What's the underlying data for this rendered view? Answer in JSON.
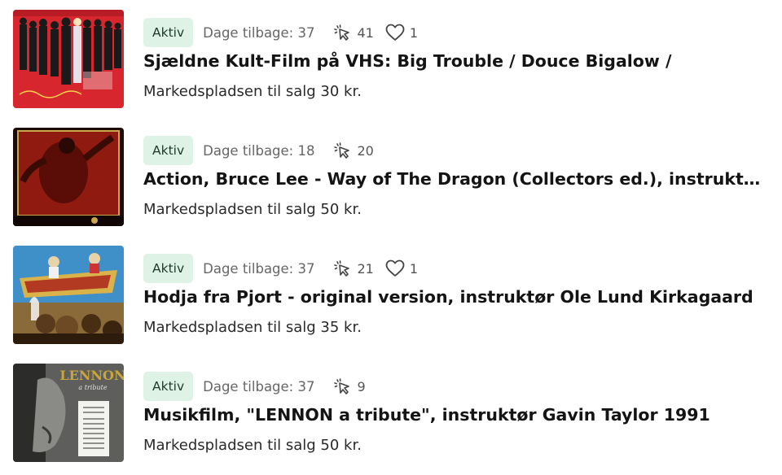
{
  "listings": [
    {
      "status": "Aktiv",
      "days_label": "Dage tilbage: 37",
      "clicks": "41",
      "likes": "1",
      "title": "Sjældne Kult-Film på VHS: Big Trouble / Douce Bigalow /",
      "price": "Markedspladsen til salg 30 kr."
    },
    {
      "status": "Aktiv",
      "days_label": "Dage tilbage: 18",
      "clicks": "20",
      "likes": null,
      "title": "Action, Bruce Lee - Way of The Dragon (Collectors ed.), instruktør R...",
      "price": "Markedspladsen til salg 50 kr."
    },
    {
      "status": "Aktiv",
      "days_label": "Dage tilbage: 37",
      "clicks": "21",
      "likes": "1",
      "title": "Hodja fra Pjort - original version, instruktør Ole Lund Kirkagaard",
      "price": "Markedspladsen til salg 35 kr."
    },
    {
      "status": "Aktiv",
      "days_label": "Dage tilbage: 37",
      "clicks": "9",
      "likes": null,
      "title": "Musikfilm, \"LENNON a tribute\", instruktør Gavin Taylor 1991",
      "price": "Markedspladsen til salg 50 kr."
    }
  ],
  "thumbnails": [
    {
      "icon": "vhs-cover-group-photo",
      "dominant_color": "#d8262e"
    },
    {
      "icon": "vhs-cover-bruce-lee",
      "dominant_color": "#8e1a10"
    },
    {
      "icon": "vhs-cover-flying-carpet",
      "dominant_color": "#3f8fc8"
    },
    {
      "icon": "vhs-cover-lennon",
      "dominant_color": "#6a6a68",
      "cover_text": [
        "LENNON",
        "a tribute"
      ]
    }
  ],
  "icons": {
    "clicks": "cursor-click-icon",
    "likes": "heart-icon"
  },
  "colors": {
    "badge_bg": "#dff2e6",
    "badge_text": "#1e3a2a",
    "title": "#141414",
    "muted": "#666666"
  }
}
